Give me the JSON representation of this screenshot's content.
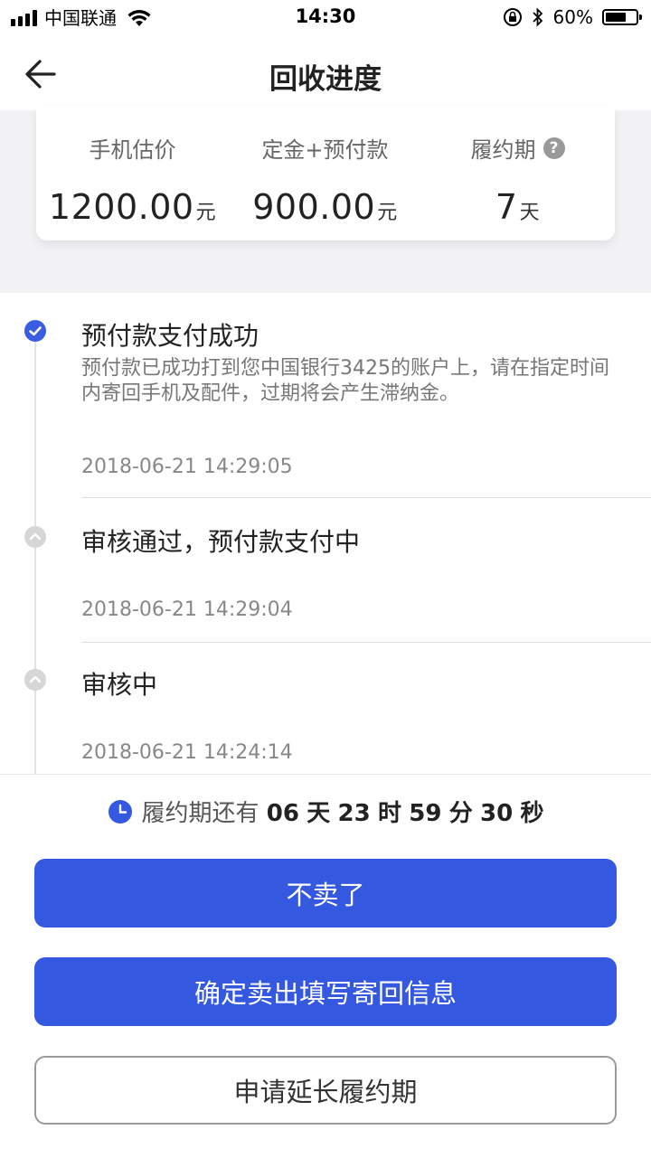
{
  "status_bar": {
    "carrier": "中国联通",
    "time": "14:30",
    "battery_percent": "60%"
  },
  "nav": {
    "title": "回收进度"
  },
  "summary": {
    "estimate_label": "手机估价",
    "estimate_value": "1200.00",
    "estimate_unit": "元",
    "deposit_label": "定金+预付款",
    "deposit_value": "900.00",
    "deposit_unit": "元",
    "period_label": "履约期",
    "period_value": "7",
    "period_unit": "天",
    "help_glyph": "?"
  },
  "timeline": [
    {
      "title": "预付款支付成功",
      "desc": "预付款已成功打到您中国银行3425的账户上，请在指定时间内寄回手机及配件，过期将会产生滞纳金。",
      "time": "2018-06-21 14:29:05",
      "state": "active"
    },
    {
      "title": "审核通过，预付款支付中",
      "time": "2018-06-21 14:29:04",
      "state": "done"
    },
    {
      "title": "审核中",
      "time": "2018-06-21 14:24:14",
      "state": "done"
    }
  ],
  "countdown": {
    "prefix": "履约期还有",
    "days": "06",
    "days_unit": "天",
    "hours": "23",
    "hours_unit": "时",
    "minutes": "59",
    "minutes_unit": "分",
    "seconds": "30",
    "seconds_unit": "秒"
  },
  "actions": {
    "cancel_sale": "不卖了",
    "confirm_sale": "确定卖出填写寄回信息",
    "extend_period": "申请延长履约期"
  },
  "colors": {
    "primary": "#3558e0",
    "active_dot": "#3a5ce0",
    "inactive_dot": "#d6d6d6"
  },
  "icons": {
    "back": "arrow-left-icon",
    "help": "question-circle-icon",
    "clock": "clock-icon",
    "check": "check-icon",
    "chevron_up": "chevron-up-icon"
  }
}
